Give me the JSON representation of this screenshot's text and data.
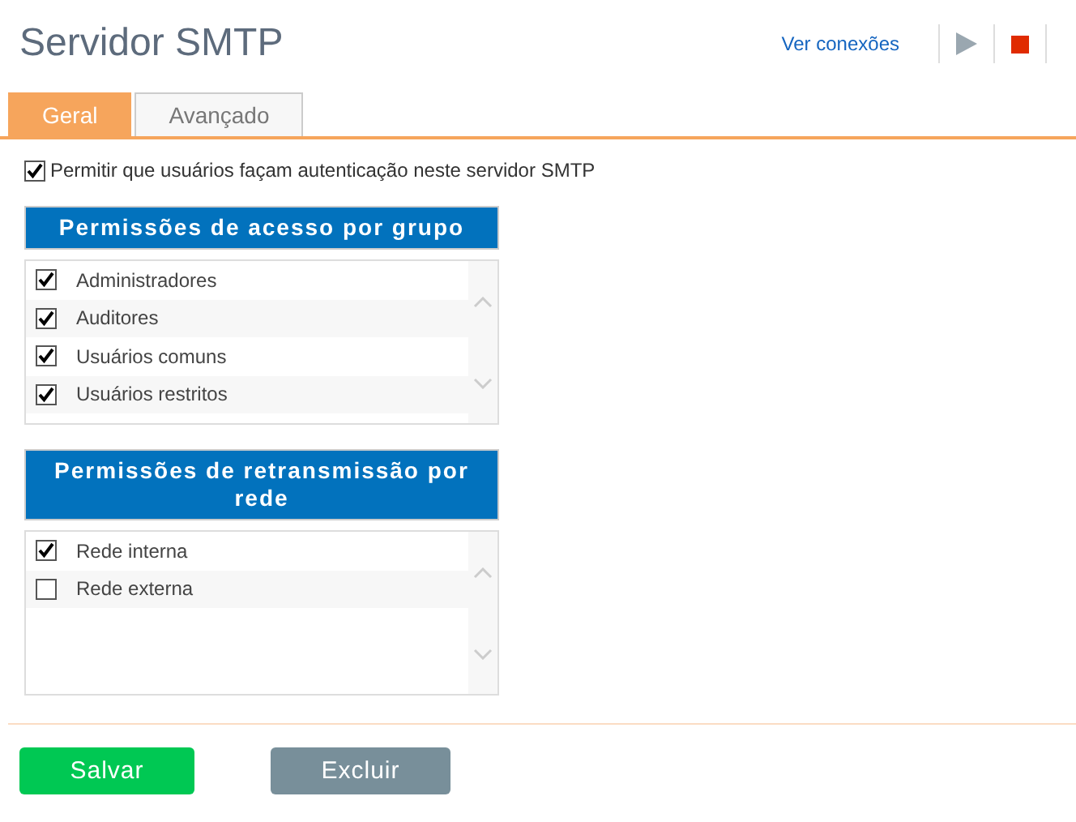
{
  "header": {
    "title": "Servidor SMTP",
    "link": "Ver conexões"
  },
  "tabs": [
    {
      "label": "Geral",
      "selected": true
    },
    {
      "label": "Avançado",
      "selected": false
    }
  ],
  "auth_option": {
    "label": "Permitir que usuários façam autenticação neste servidor SMTP",
    "checked": true
  },
  "panels": [
    {
      "title": "Permissões de acesso por grupo",
      "items": [
        {
          "label": "Administradores",
          "checked": true
        },
        {
          "label": "Auditores",
          "checked": true
        },
        {
          "label": "Usuários comuns",
          "checked": true
        },
        {
          "label": "Usuários restritos",
          "checked": true
        }
      ]
    },
    {
      "title": "Permissões de retransmissão por rede",
      "items": [
        {
          "label": "Rede interna",
          "checked": true
        },
        {
          "label": "Rede externa",
          "checked": false
        }
      ]
    }
  ],
  "buttons": [
    {
      "label": "Salvar",
      "kind": "primary"
    },
    {
      "label": "Excluir",
      "kind": "secondary"
    }
  ]
}
